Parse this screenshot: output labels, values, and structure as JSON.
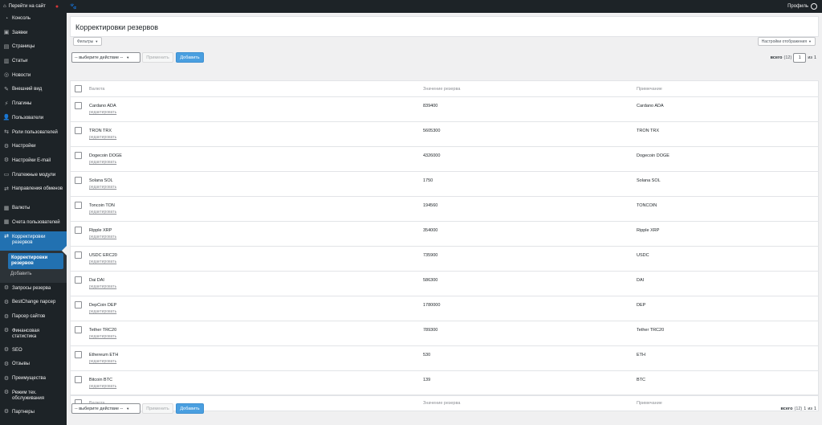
{
  "topbar": {
    "site_link": "Перейти на сайт",
    "profile": "Профиль"
  },
  "sidebar": {
    "items": [
      {
        "label": "Консоль",
        "icon": "gauge-icon"
      },
      {
        "label": "Заявки",
        "icon": "requests-icon"
      },
      {
        "label": "Страницы",
        "icon": "pages-icon"
      },
      {
        "label": "Статьи",
        "icon": "articles-icon"
      },
      {
        "label": "Новости",
        "icon": "news-icon"
      },
      {
        "label": "Внешний вид",
        "icon": "appearance-icon"
      },
      {
        "label": "Плагины",
        "icon": "plugins-icon"
      },
      {
        "label": "Пользователи",
        "icon": "users-icon"
      },
      {
        "label": "Роли пользователей",
        "icon": "roles-icon"
      },
      {
        "label": "Настройки",
        "icon": "settings-icon"
      },
      {
        "label": "Настройки E-mail",
        "icon": "email-settings-icon"
      },
      {
        "label": "Платежные модули",
        "icon": "payment-modules-icon"
      },
      {
        "label": "Направления обменов",
        "icon": "exchange-directions-icon"
      },
      {
        "label": "Валюты",
        "icon": "currencies-icon"
      },
      {
        "label": "Счета пользователей",
        "icon": "user-accounts-icon"
      },
      {
        "label": "Корректировки резервов",
        "icon": "reserve-adjustments-icon"
      },
      {
        "label": "Запросы резерва",
        "icon": "reserve-requests-icon"
      },
      {
        "label": "BestChange парсер",
        "icon": "bestchange-icon"
      },
      {
        "label": "Парсер сайтов",
        "icon": "site-parser-icon"
      },
      {
        "label": "Финансовая статистика",
        "icon": "finance-stats-icon"
      },
      {
        "label": "SEO",
        "icon": "seo-icon"
      },
      {
        "label": "Отзывы",
        "icon": "reviews-icon"
      },
      {
        "label": "Преимущества",
        "icon": "advantages-icon"
      },
      {
        "label": "Режим тех. обслуживания",
        "icon": "maintenance-icon"
      },
      {
        "label": "Партнеры",
        "icon": "partners-icon"
      }
    ],
    "submenu": {
      "current": "Корректировки резервов",
      "add": "Добавить"
    }
  },
  "page": {
    "title": "Корректировки резервов",
    "filters_label": "Фильтры",
    "display_settings": "Настройки отображения"
  },
  "bulk": {
    "select_value": "-- выберите действие --",
    "apply": "Применить",
    "add": "Добавить"
  },
  "pagination": {
    "total_label": "всего",
    "total_count": "(12)",
    "page": "1",
    "of_label": "из",
    "pages": "1"
  },
  "table": {
    "headers": [
      "Валюта",
      "Значение резерва",
      "Примечание"
    ],
    "edit_label": "редактировать",
    "rows": [
      {
        "currency": "Cardano ADA",
        "reserve": "839400",
        "note": "Cardano ADA"
      },
      {
        "currency": "TRON TRX",
        "reserve": "5605300",
        "note": "TRON TRX"
      },
      {
        "currency": "Dogecoin DOGE",
        "reserve": "4326000",
        "note": "Dogecoin DOGE"
      },
      {
        "currency": "Solana SOL",
        "reserve": "1750",
        "note": "Solana SOL"
      },
      {
        "currency": "Toncoin TON",
        "reserve": "194560",
        "note": "TONCOIN"
      },
      {
        "currency": "Ripple XRP",
        "reserve": "354000",
        "note": "Ripple XRP"
      },
      {
        "currency": "USDC ERC20",
        "reserve": "735900",
        "note": "USDC"
      },
      {
        "currency": "Dai DAI",
        "reserve": "586300",
        "note": "DAI"
      },
      {
        "currency": "DepCoin DEP",
        "reserve": "1780000",
        "note": "DEP"
      },
      {
        "currency": "Tether TRC20",
        "reserve": "789300",
        "note": "Tether TRC20"
      },
      {
        "currency": "Ethereum ETH",
        "reserve": "530",
        "note": "ETH"
      },
      {
        "currency": "Bitcoin BTC",
        "reserve": "139",
        "note": "BTC"
      }
    ]
  }
}
